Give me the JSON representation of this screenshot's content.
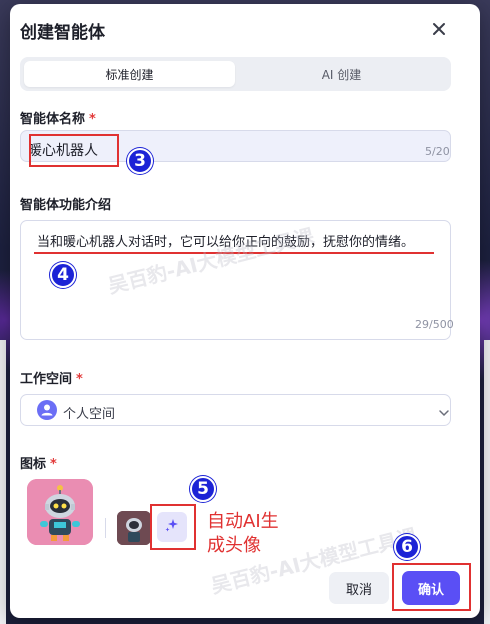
{
  "dialog": {
    "title": "创建智能体",
    "close_icon": "close-icon"
  },
  "tabs": [
    {
      "label": "标准创建",
      "active": true
    },
    {
      "label": "AI 创建",
      "active": false
    }
  ],
  "name_field": {
    "label": "智能体名称",
    "required_mark": "*",
    "value": "暖心机器人",
    "counter": "5/20"
  },
  "description_field": {
    "label": "智能体功能介绍",
    "value": "当和暖心机器人对话时，它可以给你正向的鼓励，抚慰你的情绪。",
    "counter": "29/500"
  },
  "workspace_field": {
    "label": "工作空间",
    "required_mark": "*",
    "value": "个人空间",
    "icon": "user-icon"
  },
  "icon_field": {
    "label": "图标",
    "required_mark": "*",
    "ai_generate_icon": "sparkle-icon"
  },
  "annotations": {
    "step3": "3",
    "step4": "4",
    "step5": "5",
    "step6": "6",
    "ai_note": "自动AI生\n成头像",
    "watermark": "吴百豹-AI大模型工具课"
  },
  "footer": {
    "cancel_label": "取消",
    "confirm_label": "确认"
  },
  "colors": {
    "accent": "#5a4ff5",
    "annotation_red": "#e03131",
    "badge_blue": "#1c23d6"
  }
}
